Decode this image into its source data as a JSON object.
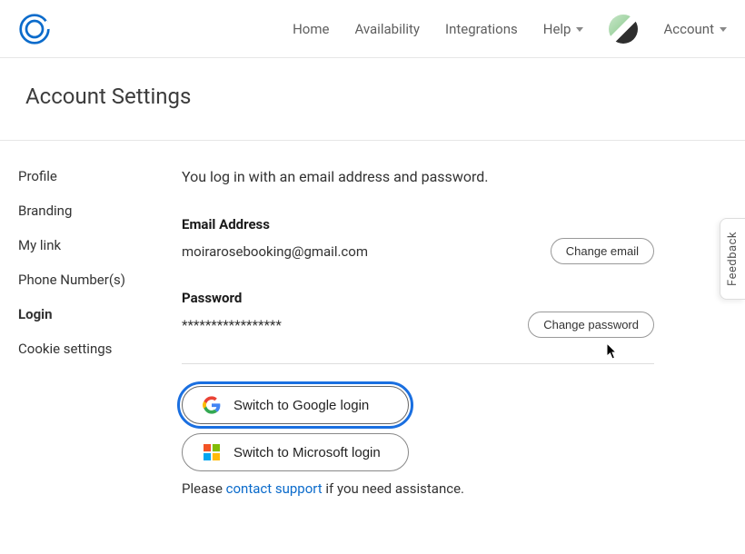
{
  "nav": {
    "home": "Home",
    "availability": "Availability",
    "integrations": "Integrations",
    "help": "Help",
    "account": "Account"
  },
  "page": {
    "title": "Account Settings"
  },
  "sidebar": {
    "items": [
      {
        "label": "Profile"
      },
      {
        "label": "Branding"
      },
      {
        "label": "My link"
      },
      {
        "label": "Phone Number(s)"
      },
      {
        "label": "Login"
      },
      {
        "label": "Cookie settings"
      }
    ],
    "active_index": 4
  },
  "login": {
    "intro": "You log in with an email address and password.",
    "email_label": "Email Address",
    "email_value": "moirarosebooking@gmail.com",
    "change_email_btn": "Change email",
    "password_label": "Password",
    "password_value": "*****************",
    "change_password_btn": "Change password",
    "switch_google": "Switch to Google login",
    "switch_microsoft": "Switch to Microsoft login",
    "assist_prefix": "Please ",
    "assist_link": "contact support",
    "assist_suffix": " if you need assistance."
  },
  "feedback": {
    "label": "Feedback"
  },
  "icons": {
    "logo": "calendly-logo",
    "google": "google-icon",
    "microsoft": "microsoft-icon",
    "caret": "caret-down-icon",
    "avatar": "avatar-icon"
  },
  "colors": {
    "link": "#0b6bcb",
    "focus_ring": "#1a6fe0",
    "border": "#e6e6e6"
  }
}
